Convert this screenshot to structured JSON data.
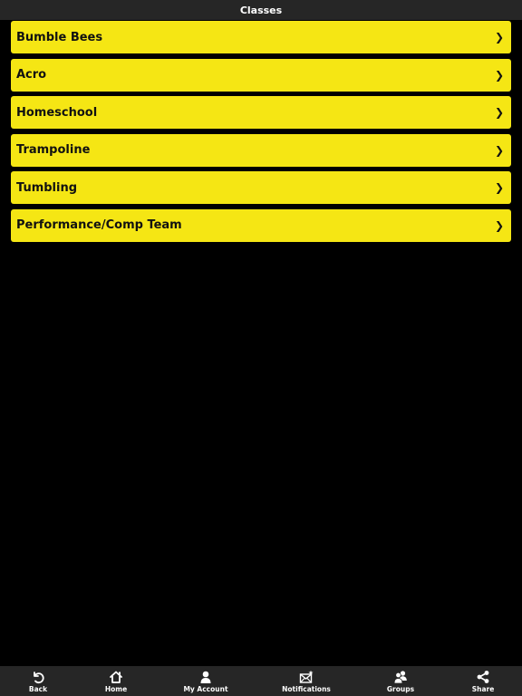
{
  "header": {
    "title": "Classes"
  },
  "classes": [
    {
      "label": "Bumble Bees",
      "chevron": "❯"
    },
    {
      "label": "Acro",
      "chevron": "❯"
    },
    {
      "label": "Homeschool",
      "chevron": "❯"
    },
    {
      "label": "Trampoline",
      "chevron": "❯"
    },
    {
      "label": "Tumbling",
      "chevron": "❯"
    },
    {
      "label": "Performance/Comp Team",
      "chevron": "❯"
    }
  ],
  "tabbar": {
    "items": [
      {
        "label": "Back",
        "icon": "back-icon"
      },
      {
        "label": "Home",
        "icon": "home-icon"
      },
      {
        "label": "My Account",
        "icon": "user-icon"
      },
      {
        "label": "Notifications",
        "icon": "envelope-star-icon"
      },
      {
        "label": "Groups",
        "icon": "group-icon"
      },
      {
        "label": "Share",
        "icon": "share-icon"
      }
    ]
  },
  "colors": {
    "background": "#000000",
    "bar": "#262626",
    "item": "#f5e614",
    "item_text": "#111111",
    "bar_text": "#ffffff"
  }
}
